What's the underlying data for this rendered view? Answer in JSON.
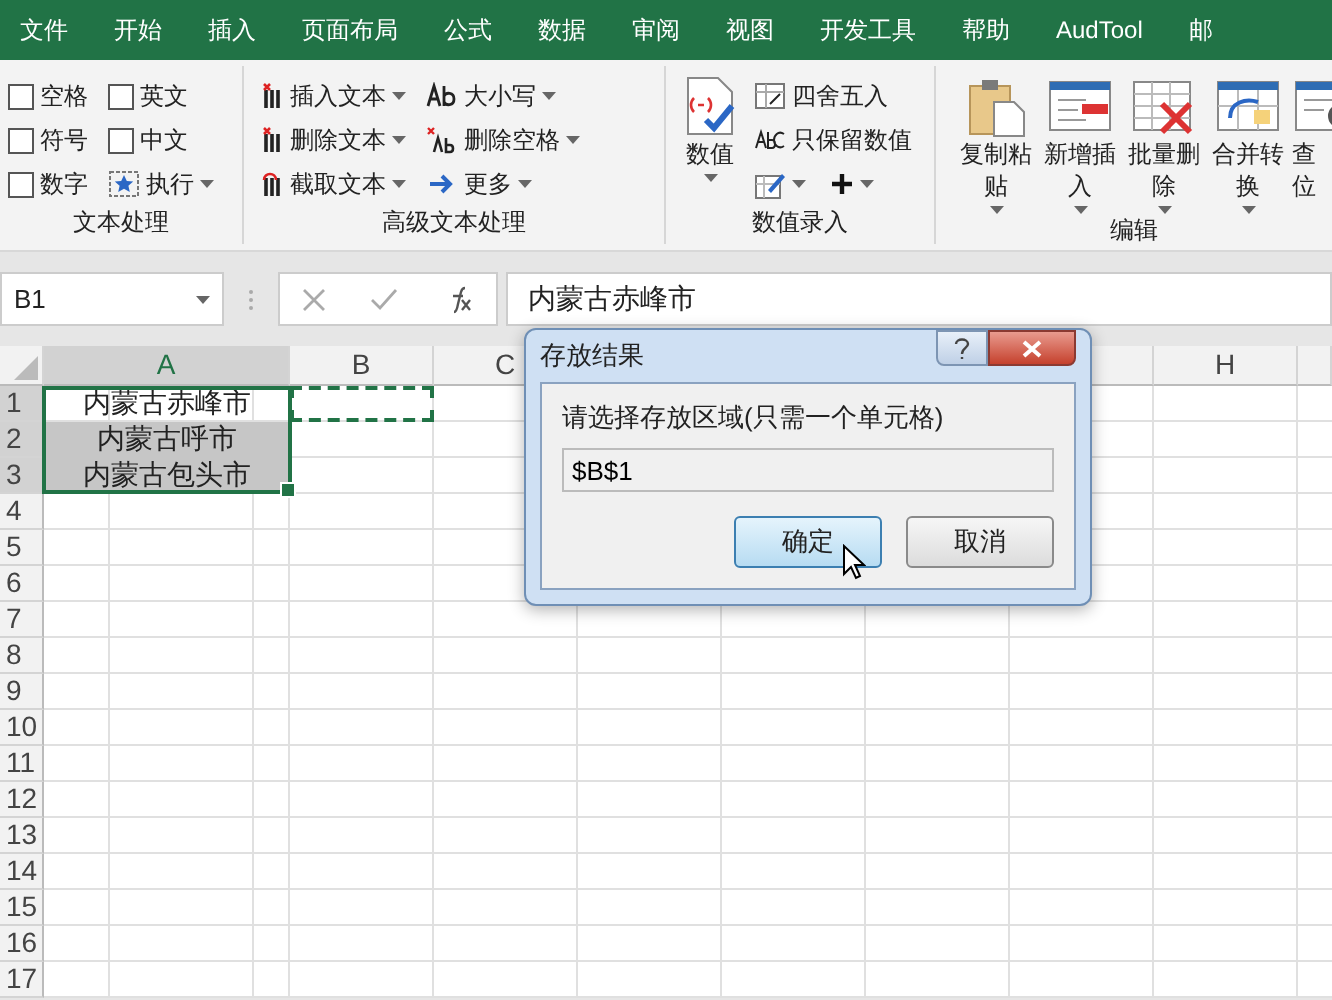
{
  "menu_tabs": [
    {
      "label": "文件"
    },
    {
      "label": "开始"
    },
    {
      "label": "插入"
    },
    {
      "label": "页面布局"
    },
    {
      "label": "公式"
    },
    {
      "label": "数据"
    },
    {
      "label": "审阅"
    },
    {
      "label": "视图"
    },
    {
      "label": "开发工具"
    },
    {
      "label": "帮助"
    },
    {
      "label": "AudTool"
    },
    {
      "label": "邮"
    }
  ],
  "ribbon": {
    "groups": [
      {
        "label": "文本处理",
        "items": [
          {
            "kind": "checkbox",
            "label": "空格",
            "checked": false
          },
          {
            "kind": "checkbox",
            "label": "符号",
            "checked": false
          },
          {
            "kind": "checkbox",
            "label": "数字",
            "checked": false
          },
          {
            "kind": "checkbox",
            "label": "英文",
            "checked": false
          },
          {
            "kind": "checkbox",
            "label": "中文",
            "checked": false
          },
          {
            "kind": "small",
            "label": "执行",
            "dropdown": true
          }
        ]
      },
      {
        "label": "高级文本处理",
        "items": [
          {
            "kind": "small",
            "label": "插入文本",
            "dropdown": true
          },
          {
            "kind": "small",
            "label": "删除文本",
            "dropdown": true
          },
          {
            "kind": "small",
            "label": "截取文本",
            "dropdown": true
          },
          {
            "kind": "small",
            "label": "大小写",
            "dropdown": true
          },
          {
            "kind": "small",
            "label": "删除空格",
            "dropdown": true
          },
          {
            "kind": "small",
            "label": "更多",
            "dropdown": true
          }
        ]
      },
      {
        "label": "数值录入",
        "items": [
          {
            "kind": "large",
            "lines": [
              "数值"
            ],
            "dropdown": true
          },
          {
            "kind": "small",
            "label": "四舍五入",
            "dropdown": false
          },
          {
            "kind": "small",
            "label": "只保留数值",
            "dropdown": false
          },
          {
            "kind": "iconpair",
            "dropdown": true
          }
        ]
      },
      {
        "label": "编辑",
        "items": [
          {
            "kind": "large",
            "lines": [
              "复制粘",
              "贴"
            ],
            "dropdown": true
          },
          {
            "kind": "large",
            "lines": [
              "新增插",
              "入"
            ],
            "dropdown": true
          },
          {
            "kind": "large",
            "lines": [
              "批量删",
              "除"
            ],
            "dropdown": true
          },
          {
            "kind": "large",
            "lines": [
              "合并转",
              "换"
            ],
            "dropdown": true
          },
          {
            "kind": "large",
            "lines": [
              "查",
              "位"
            ],
            "dropdown": false
          }
        ]
      }
    ]
  },
  "formula_bar": {
    "name_box": "B1",
    "content": "内蒙古赤峰市"
  },
  "sheet": {
    "columns": [
      {
        "label": "A"
      },
      {
        "label": "B"
      },
      {
        "label": "C"
      },
      {
        "label": "H"
      }
    ],
    "rows": [
      {
        "number": "1",
        "cells": [
          {
            "value": "内蒙古赤峰市",
            "selected": true,
            "active": true
          },
          {
            "copy_marquee": true
          }
        ]
      },
      {
        "number": "2",
        "cells": [
          {
            "value": "内蒙古呼市",
            "selected": true,
            "active": false
          }
        ]
      },
      {
        "number": "3",
        "cells": [
          {
            "value": "内蒙古包头市",
            "selected": true,
            "active": false
          }
        ]
      },
      {
        "number": "4"
      },
      {
        "number": "5"
      },
      {
        "number": "6"
      },
      {
        "number": "7"
      },
      {
        "number": "8"
      },
      {
        "number": "9"
      },
      {
        "number": "10"
      },
      {
        "number": "11"
      },
      {
        "number": "12"
      },
      {
        "number": "13"
      },
      {
        "number": "14"
      },
      {
        "number": "15"
      },
      {
        "number": "16"
      },
      {
        "number": "17"
      }
    ]
  },
  "dialog": {
    "title": "存放结果",
    "prompt": "请选择存放区域(只需一个单元格)",
    "value": "$B$1",
    "buttons": [
      {
        "label": "确定",
        "selected": true
      },
      {
        "label": "取消",
        "selected": false
      }
    ]
  }
}
